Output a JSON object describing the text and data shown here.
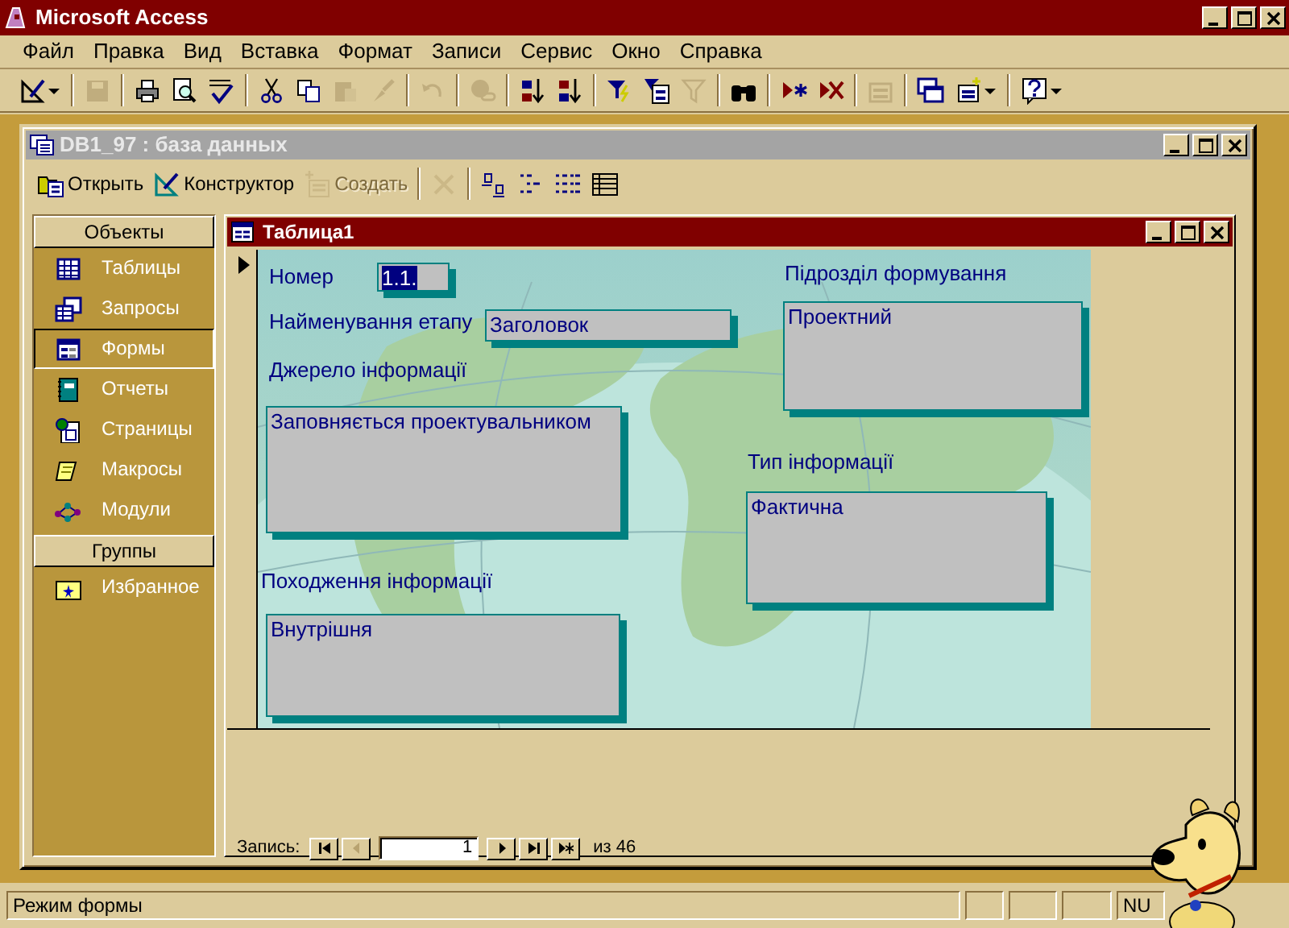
{
  "app": {
    "title": "Microsoft Access"
  },
  "menu": [
    "Файл",
    "Правка",
    "Вид",
    "Вставка",
    "Формат",
    "Записи",
    "Сервис",
    "Окно",
    "Справка"
  ],
  "toolbar": [
    {
      "kind": "view",
      "disabled": false,
      "dropdown": true
    },
    {
      "kind": "sep"
    },
    {
      "kind": "save",
      "disabled": true
    },
    {
      "kind": "sep"
    },
    {
      "kind": "print",
      "disabled": false
    },
    {
      "kind": "preview",
      "disabled": false
    },
    {
      "kind": "spell",
      "disabled": false
    },
    {
      "kind": "sep"
    },
    {
      "kind": "cut",
      "disabled": false
    },
    {
      "kind": "copy",
      "disabled": false
    },
    {
      "kind": "paste",
      "disabled": true
    },
    {
      "kind": "brush",
      "disabled": true
    },
    {
      "kind": "sep"
    },
    {
      "kind": "undo",
      "disabled": true
    },
    {
      "kind": "sep"
    },
    {
      "kind": "globe",
      "disabled": true
    },
    {
      "kind": "sep"
    },
    {
      "kind": "sortasc",
      "disabled": false
    },
    {
      "kind": "sortdesc",
      "disabled": false
    },
    {
      "kind": "sep"
    },
    {
      "kind": "filtersel",
      "disabled": false
    },
    {
      "kind": "filterform",
      "disabled": false
    },
    {
      "kind": "funnel",
      "disabled": true
    },
    {
      "kind": "sep"
    },
    {
      "kind": "find",
      "disabled": false
    },
    {
      "kind": "sep"
    },
    {
      "kind": "newrec",
      "disabled": false
    },
    {
      "kind": "delrec",
      "disabled": false
    },
    {
      "kind": "sep"
    },
    {
      "kind": "props",
      "disabled": true
    },
    {
      "kind": "sep"
    },
    {
      "kind": "dbwin",
      "disabled": false
    },
    {
      "kind": "newobj",
      "disabled": false,
      "dropdown": true
    },
    {
      "kind": "sep"
    },
    {
      "kind": "help",
      "disabled": false,
      "dropdown": true
    }
  ],
  "db_window": {
    "title": "DB1_97 : база данных",
    "toolbar": [
      {
        "kind": "open",
        "label": "Открыть",
        "disabled": false
      },
      {
        "kind": "design",
        "label": "Конструктор",
        "disabled": false
      },
      {
        "kind": "create",
        "label": "Создать",
        "disabled": true
      },
      {
        "kind": "sep"
      },
      {
        "kind": "delete",
        "disabled": true
      },
      {
        "kind": "sep"
      },
      {
        "kind": "largeicons",
        "disabled": false
      },
      {
        "kind": "smallicons",
        "disabled": false
      },
      {
        "kind": "list",
        "disabled": false
      },
      {
        "kind": "details",
        "disabled": false
      }
    ],
    "objects_header": "Объекты",
    "objects": [
      {
        "kind": "tables",
        "label": "Таблицы",
        "selected": false
      },
      {
        "kind": "queries",
        "label": "Запросы",
        "selected": false
      },
      {
        "kind": "forms",
        "label": "Формы",
        "selected": true
      },
      {
        "kind": "reports",
        "label": "Отчеты",
        "selected": false
      },
      {
        "kind": "pages",
        "label": "Страницы",
        "selected": false
      },
      {
        "kind": "macros",
        "label": "Макросы",
        "selected": false
      },
      {
        "kind": "modules",
        "label": "Модули",
        "selected": false
      }
    ],
    "groups_header": "Группы",
    "groups": [
      {
        "kind": "favorites",
        "label": "Избранное",
        "selected": false
      }
    ]
  },
  "form_window": {
    "title": "Таблица1",
    "fields": [
      {
        "label": "Номер",
        "value": "1.1.",
        "focused": true
      },
      {
        "label": "Найменування етапу",
        "value": "Заголовок",
        "focused": false
      },
      {
        "label": "Джерело інформації",
        "value": "Заповняється проектувальником",
        "focused": false
      },
      {
        "label": "Підрозділ формування",
        "value": "Проектний",
        "focused": false
      },
      {
        "label": "Тип інформації",
        "value": "Фактична",
        "focused": false
      },
      {
        "label": "Походження інформації",
        "value": "Внутрішня",
        "focused": false
      }
    ],
    "navigation": {
      "label": "Запись:",
      "current": "1",
      "total": "из 46"
    }
  },
  "status_bar": {
    "text": "Режим формы",
    "indicator": "NU"
  }
}
